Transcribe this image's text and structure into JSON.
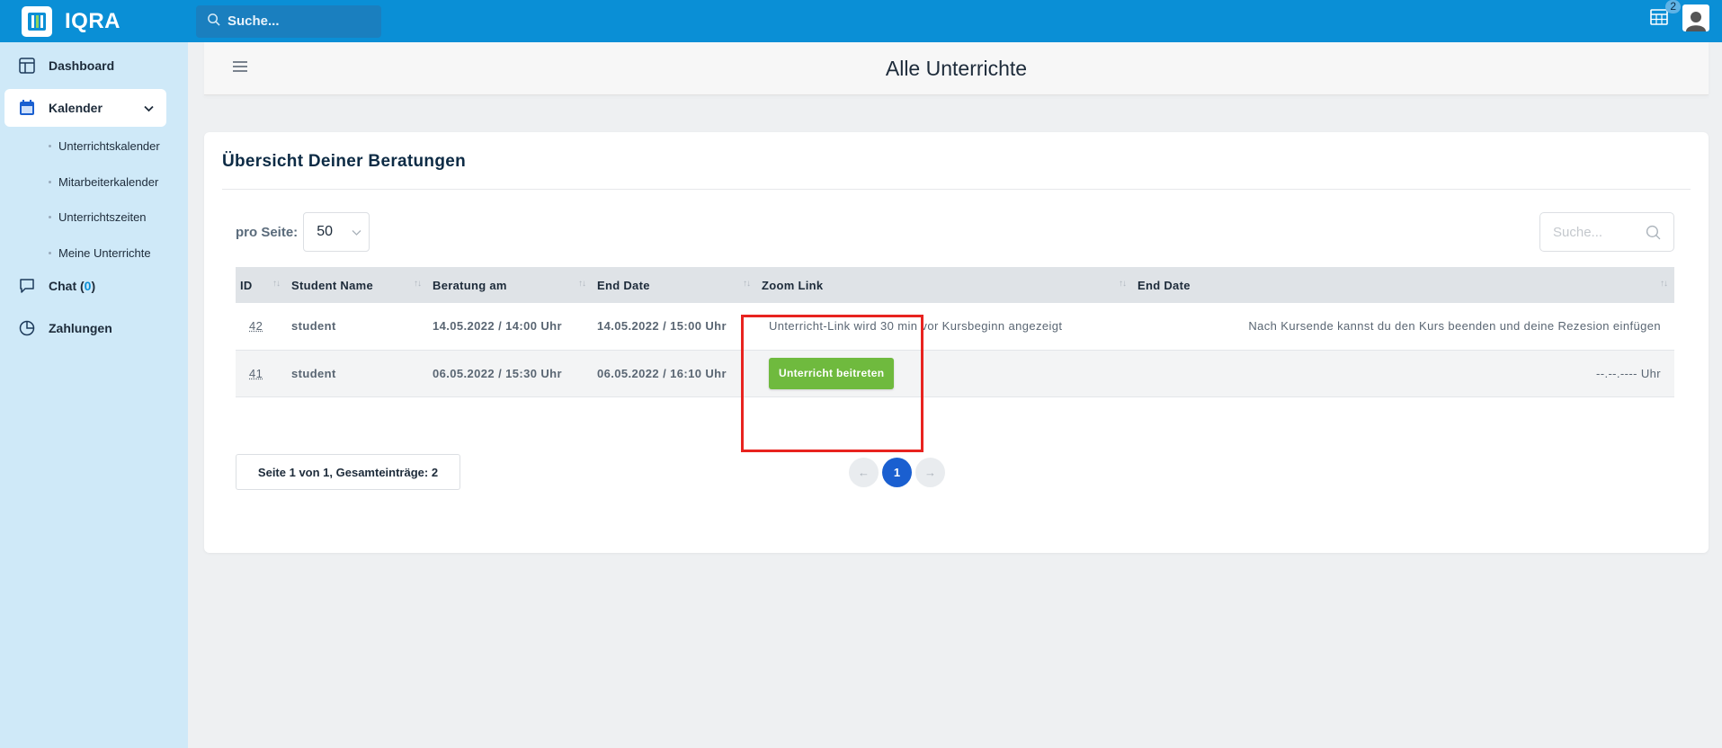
{
  "app": {
    "name": "IQRA"
  },
  "topbar": {
    "search_placeholder": "Suche...",
    "calendar_badge": "2"
  },
  "sidebar": {
    "items": [
      {
        "label": "Dashboard"
      },
      {
        "label": "Kalender"
      },
      {
        "label": "Chat (",
        "count": "0",
        "suffix": ")"
      },
      {
        "label": "Zahlungen"
      }
    ],
    "kalender_sub": [
      "Unterrichtskalender",
      "Mitarbeiterkalender",
      "Unterrichtszeiten",
      "Meine Unterrichte"
    ]
  },
  "header": {
    "title": "Alle Unterrichte"
  },
  "card": {
    "title": "Übersicht Deiner Beratungen",
    "per_page_label": "pro Seite:",
    "per_page_value": "50",
    "search_placeholder": "Suche...",
    "columns": [
      "ID",
      "Student Name",
      "Beratung am",
      "End Date",
      "Zoom Link",
      "End Date"
    ],
    "rows": [
      {
        "id": "42",
        "student": "student",
        "beratung": "14.05.2022 / 14:00 Uhr",
        "end": "14.05.2022 / 15:00 Uhr",
        "zoom": "Unterricht-Link wird 30 min vor Kursbeginn angezeigt",
        "end2": "Nach Kursende kannst du den Kurs beenden und deine Rezesion einfügen"
      },
      {
        "id": "41",
        "student": "student",
        "beratung": "06.05.2022 / 15:30 Uhr",
        "end": "06.05.2022 / 16:10 Uhr",
        "zoom_button": "Unterricht beitreten",
        "end2": "--.--.---- Uhr"
      }
    ],
    "page_info": "Seite 1 von 1, Gesamteinträge: 2",
    "pagination": {
      "current": "1",
      "prev": "←",
      "next": "→"
    }
  },
  "colors": {
    "topbar": "#0a8fd6",
    "sidebar": "#cfe9f8",
    "accent_button": "#6fba3e",
    "active_page": "#1a5fd0",
    "highlight": "#e8231f"
  }
}
